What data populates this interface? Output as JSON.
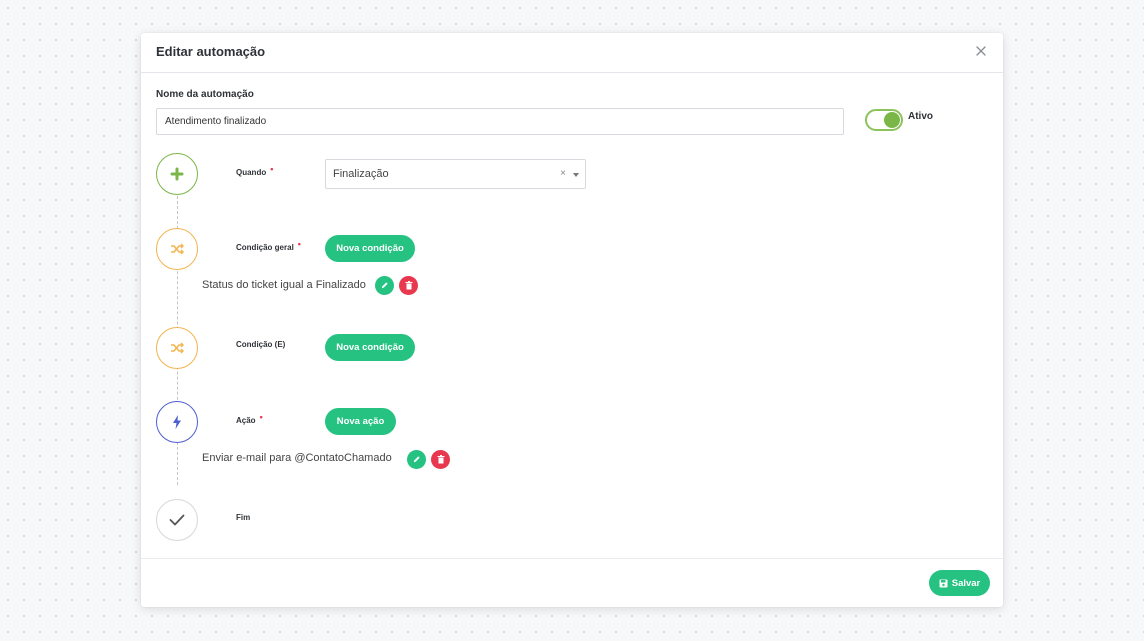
{
  "modal": {
    "title": "Editar automação",
    "close_icon": "close-icon"
  },
  "form": {
    "name_label": "Nome da automação",
    "name_value": "Atendimento finalizado",
    "toggle_label": "Ativo",
    "toggle_on": true
  },
  "steps": {
    "when": {
      "label": "Quando",
      "required": "•",
      "icon": "plus-icon",
      "select_value": "Finalização",
      "clear_symbol": "×"
    },
    "general_condition": {
      "label": "Condição geral",
      "required": "•",
      "icon": "shuffle-icon",
      "button": "Nova condição",
      "rule": "Status do ticket igual a Finalizado"
    },
    "and_condition": {
      "label": "Condição (E)",
      "icon": "shuffle-icon",
      "button": "Nova condição"
    },
    "action": {
      "label": "Ação",
      "required": "•",
      "icon": "lightning-icon",
      "button": "Nova ação",
      "rule": "Enviar e-mail para @ContatoChamado"
    },
    "end": {
      "label": "Fim",
      "icon": "check-icon"
    }
  },
  "footer": {
    "save_label": "Salvar",
    "save_icon": "floppy-disk-icon"
  },
  "colors": {
    "accent_green": "#26c281",
    "delete_red": "#e8384f",
    "step_green": "#7ab648",
    "step_orange": "#f3b44f",
    "step_blue": "#4e5ed3"
  }
}
